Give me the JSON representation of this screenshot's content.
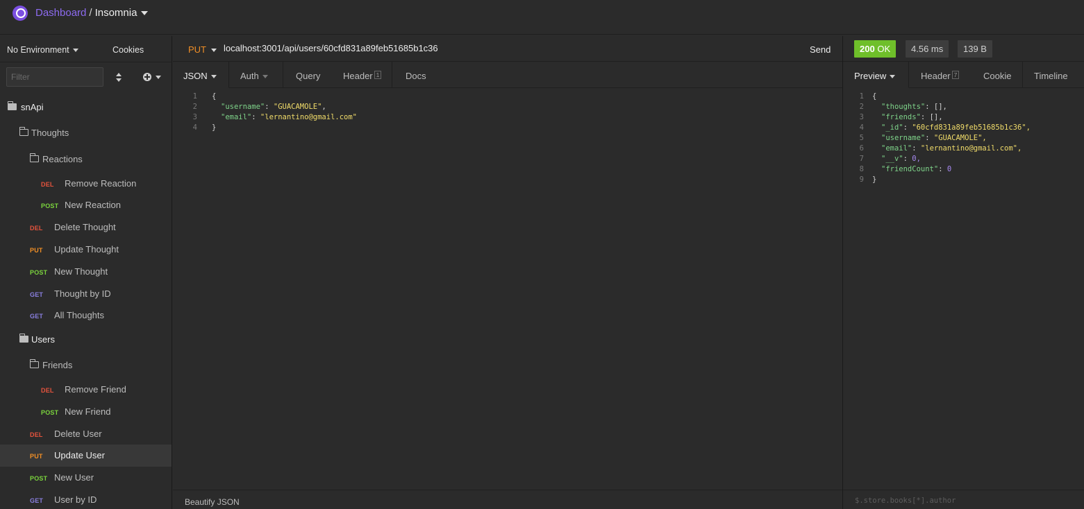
{
  "header": {
    "breadcrumb_dashboard": "Dashboard",
    "breadcrumb_separator": "/",
    "workspace": "Insomnia"
  },
  "sidebar": {
    "environment": "No Environment",
    "cookies": "Cookies",
    "filter_placeholder": "Filter",
    "tree": [
      {
        "type": "folder",
        "label": "snApi"
      },
      {
        "type": "folder",
        "label": "Thoughts"
      },
      {
        "type": "folder",
        "label": "Reactions"
      },
      {
        "type": "request",
        "method": "DEL",
        "label": "Remove Reaction"
      },
      {
        "type": "request",
        "method": "POST",
        "label": "New Reaction"
      },
      {
        "type": "request",
        "method": "DEL",
        "label": "Delete Thought"
      },
      {
        "type": "request",
        "method": "PUT",
        "label": "Update Thought"
      },
      {
        "type": "request",
        "method": "POST",
        "label": "New Thought"
      },
      {
        "type": "request",
        "method": "GET",
        "label": "Thought by ID"
      },
      {
        "type": "request",
        "method": "GET",
        "label": "All Thoughts"
      },
      {
        "type": "folder",
        "label": "Users"
      },
      {
        "type": "folder",
        "label": "Friends"
      },
      {
        "type": "request",
        "method": "DEL",
        "label": "Remove Friend"
      },
      {
        "type": "request",
        "method": "POST",
        "label": "New Friend"
      },
      {
        "type": "request",
        "method": "DEL",
        "label": "Delete User"
      },
      {
        "type": "request",
        "method": "PUT",
        "label": "Update User",
        "active": true
      },
      {
        "type": "request",
        "method": "POST",
        "label": "New User"
      },
      {
        "type": "request",
        "method": "GET",
        "label": "User by ID"
      }
    ]
  },
  "request": {
    "method": "PUT",
    "url": "localhost:3001/api/users/60cfd831a89feb51685b1c36",
    "send_label": "Send",
    "tabs": {
      "body": "JSON",
      "auth": "Auth",
      "query": "Query",
      "header": "Header",
      "header_count": "1",
      "docs": "Docs"
    },
    "body_lines": [
      {
        "n": "1",
        "text": "{"
      },
      {
        "n": "2",
        "key": "\"username\"",
        "value": "\"GUACAMOLE\""
      },
      {
        "n": "3",
        "key": "\"email\"",
        "value": "\"lernantino@gmail.com\""
      },
      {
        "n": "4",
        "text": "}"
      }
    ],
    "beautify_label": "Beautify JSON"
  },
  "response": {
    "status": "200 OK",
    "status_code": "200",
    "status_text": "OK",
    "time": "4.56 ms",
    "size": "139 B",
    "tabs": {
      "preview": "Preview",
      "header": "Header",
      "header_count": "7",
      "cookie": "Cookie",
      "timeline": "Timeline"
    },
    "body_lines": [
      {
        "n": "1",
        "text": "{"
      },
      {
        "n": "2",
        "key": "\"thoughts\"",
        "raw": "[],"
      },
      {
        "n": "3",
        "key": "\"friends\"",
        "raw": "[],"
      },
      {
        "n": "4",
        "key": "\"_id\"",
        "value": "\"60cfd831a89feb51685b1c36\","
      },
      {
        "n": "5",
        "key": "\"username\"",
        "value": "\"GUACAMOLE\","
      },
      {
        "n": "6",
        "key": "\"email\"",
        "value": "\"lernantino@gmail.com\","
      },
      {
        "n": "7",
        "key": "\"__v\"",
        "num": "0,"
      },
      {
        "n": "8",
        "key": "\"friendCount\"",
        "num": "0"
      },
      {
        "n": "9",
        "text": "}"
      }
    ],
    "filter_placeholder": "$.store.books[*].author"
  },
  "colors": {
    "accent": "#7b4fe0",
    "status_ok": "#6fbf2a",
    "method_del": "#e5533d",
    "method_post": "#7bd43d",
    "method_put": "#f18f26",
    "method_get": "#8a7fe0"
  }
}
